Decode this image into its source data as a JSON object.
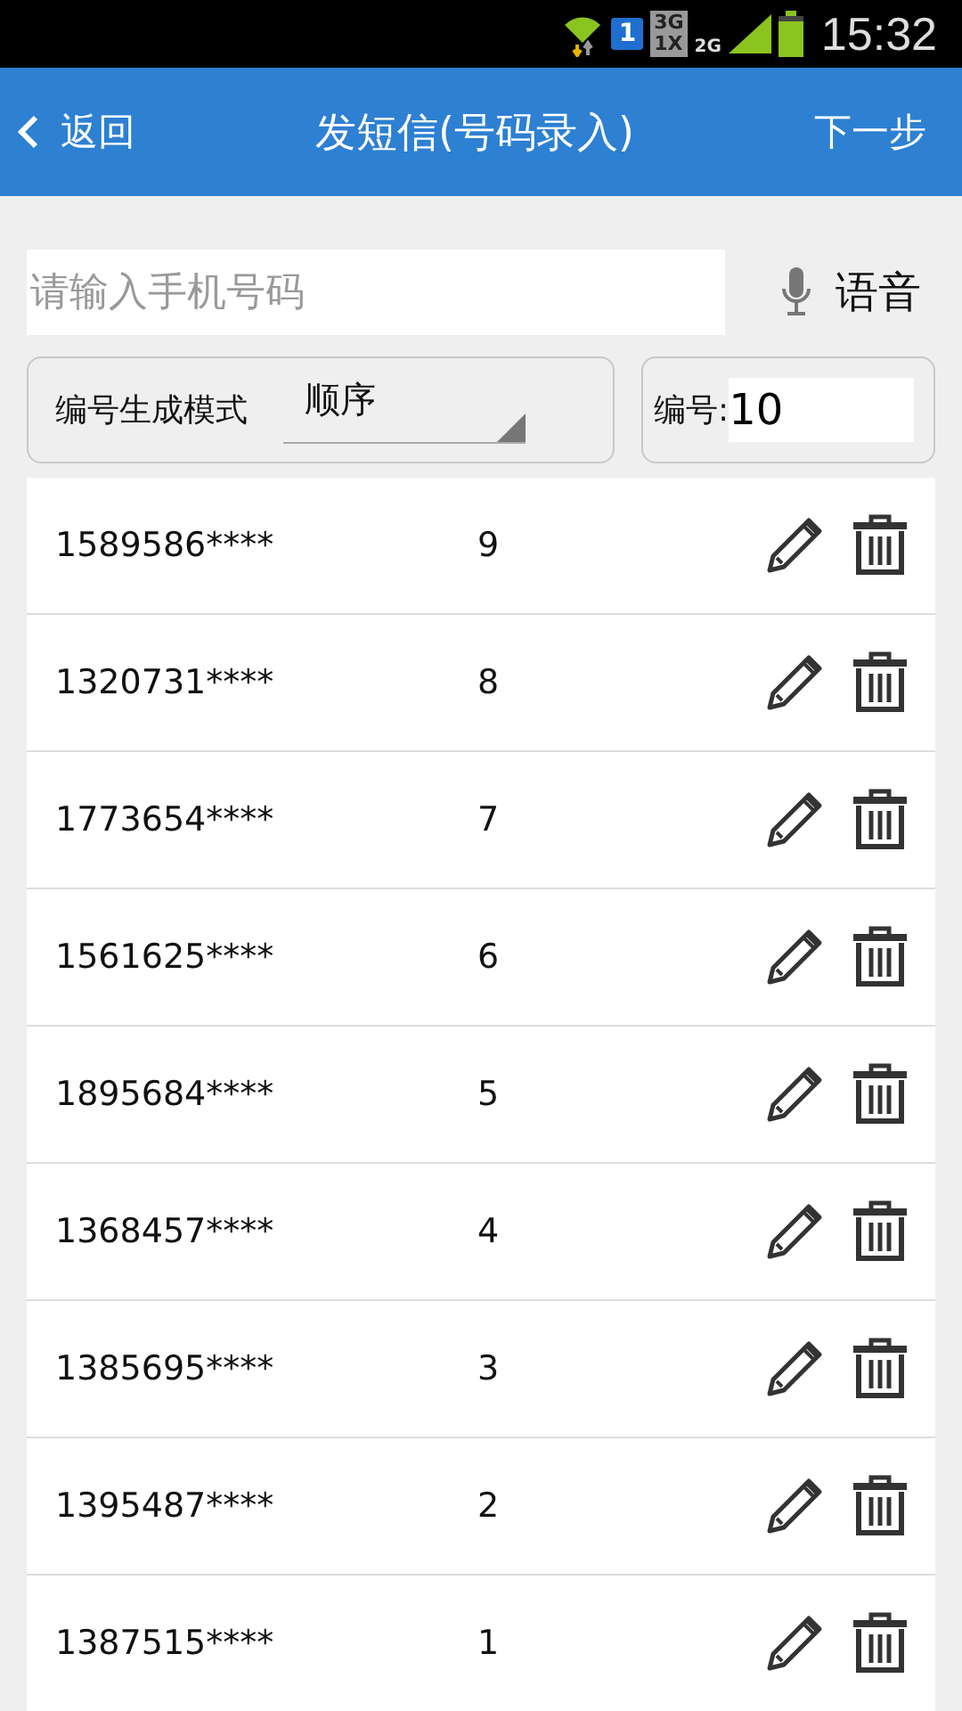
{
  "status_bar": {
    "sim": "1",
    "network_a": "3G",
    "network_b": "1X",
    "network_c": "2G",
    "time": "15:32"
  },
  "header": {
    "back": "返回",
    "title": "发短信(号码录入)",
    "next": "下一步"
  },
  "search": {
    "placeholder": "请输入手机号码",
    "voice": "语音"
  },
  "mode": {
    "label": "编号生成模式",
    "value": "顺序"
  },
  "number": {
    "label": "编号:",
    "value": "10"
  },
  "rows": [
    {
      "phone": "1589586****",
      "index": "9"
    },
    {
      "phone": "1320731****",
      "index": "8"
    },
    {
      "phone": "1773654****",
      "index": "7"
    },
    {
      "phone": "1561625****",
      "index": "6"
    },
    {
      "phone": "1895684****",
      "index": "5"
    },
    {
      "phone": "1368457****",
      "index": "4"
    },
    {
      "phone": "1385695****",
      "index": "3"
    },
    {
      "phone": "1395487****",
      "index": "2"
    },
    {
      "phone": "1387515****",
      "index": "1"
    }
  ]
}
